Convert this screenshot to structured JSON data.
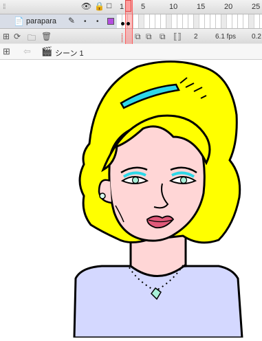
{
  "timeline": {
    "frame_numbers": [
      "1",
      "5",
      "10",
      "15",
      "20",
      "25"
    ],
    "layer_name": "parapara",
    "current_frame": "2",
    "frame_rate": "6.1 fps",
    "elapsed": "0.2"
  },
  "scene": {
    "label": "シーン 1"
  },
  "colors": {
    "hair": "#ffff00",
    "skin": "#ffd6d6",
    "headband": "#2ed8e8",
    "shirt": "#d4d8ff",
    "layer_swatch": "#b44ee0"
  }
}
